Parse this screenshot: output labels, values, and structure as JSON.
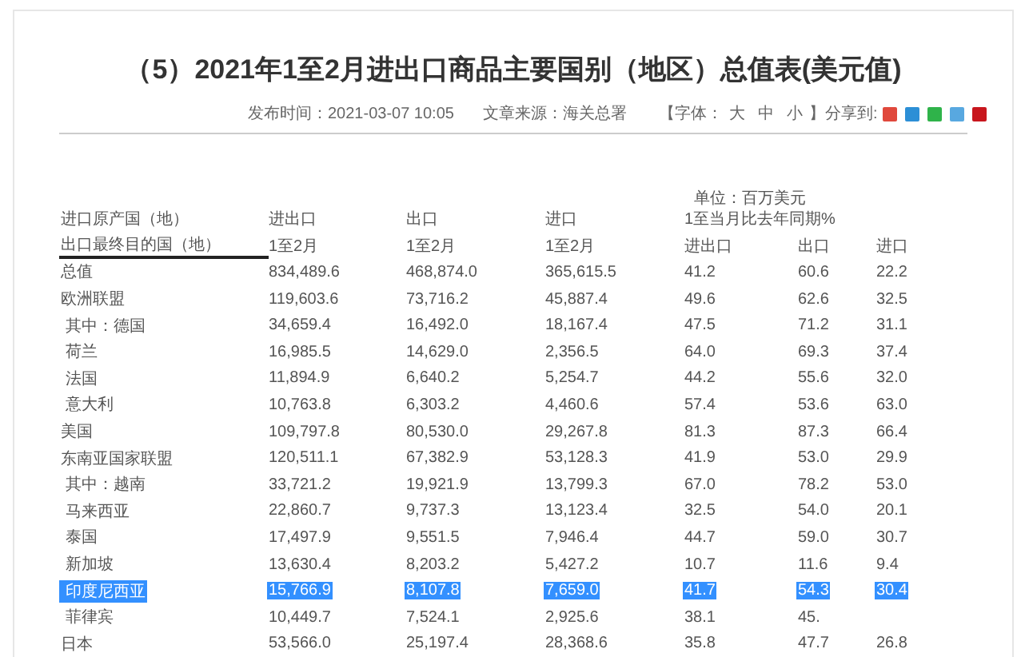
{
  "title": "（5）2021年1至2月进出口商品主要国别（地区）总值表(美元值)",
  "meta": {
    "published": "发布时间：2021-03-07 10:05",
    "source": "文章来源：海关总署",
    "font_label": "【字体：",
    "font_sizes": [
      "大",
      "中",
      "小"
    ],
    "font_end": "】",
    "share_label": "分享到:"
  },
  "share_icons": [
    {
      "color": "#e0483c"
    },
    {
      "color": "#2c8fd6"
    },
    {
      "color": "#2fb34a"
    },
    {
      "color": "#58a8e0"
    },
    {
      "color": "#c8161d"
    }
  ],
  "table": {
    "unit": "单位：百万美元",
    "header_1": [
      "进口原产国（地）",
      "进出口",
      "出口",
      "进口",
      "1至当月比去年同期%"
    ],
    "header_2": [
      "出口最终目的国（地）",
      "1至2月",
      "1至2月",
      "1至2月",
      "进出口",
      "出口",
      "进口"
    ],
    "rows": [
      {
        "cells": [
          "总值",
          "834,489.6",
          "468,874.0",
          "365,615.5",
          "41.2",
          "60.6",
          "22.2"
        ],
        "selected": false
      },
      {
        "cells": [
          "欧洲联盟",
          "119,603.6",
          "73,716.2",
          "45,887.4",
          "49.6",
          "62.6",
          "32.5"
        ],
        "selected": false,
        "children": [
          {
            "cells": [
              "其中：德国",
              "34,659.4",
              "16,492.0",
              "18,167.4",
              "47.5",
              "71.2",
              "31.1"
            ],
            "selected": false
          },
          {
            "cells": [
              "荷兰",
              "16,985.5",
              "14,629.0",
              "2,356.5",
              "64.0",
              "69.3",
              "37.4"
            ],
            "selected": false
          },
          {
            "cells": [
              "法国",
              "11,894.9",
              "6,640.2",
              "5,254.7",
              "44.2",
              "55.6",
              "32.0"
            ],
            "selected": false
          },
          {
            "cells": [
              "意大利",
              "10,763.8",
              "6,303.2",
              "4,460.6",
              "57.4",
              "53.6",
              "63.0"
            ],
            "selected": false
          }
        ]
      },
      {
        "cells": [
          "美国",
          "109,797.8",
          "80,530.0",
          "29,267.8",
          "81.3",
          "87.3",
          "66.4"
        ],
        "selected": false
      },
      {
        "cells": [
          "东南亚国家联盟",
          "120,511.1",
          "67,382.9",
          "53,128.3",
          "41.9",
          "53.0",
          "29.9"
        ],
        "selected": false,
        "children": [
          {
            "cells": [
              "其中：越南",
              "33,721.2",
              "19,921.9",
              "13,799.3",
              "67.0",
              "78.2",
              "53.0"
            ],
            "selected": false
          },
          {
            "cells": [
              "马来西亚",
              "22,860.7",
              "9,737.3",
              "13,123.4",
              "32.5",
              "54.0",
              "20.1"
            ],
            "selected": false
          },
          {
            "cells": [
              "泰国",
              "17,497.9",
              "9,551.5",
              "7,946.4",
              "44.7",
              "59.0",
              "30.7"
            ],
            "selected": false
          },
          {
            "cells": [
              "新加坡",
              "13,630.4",
              "8,203.2",
              "5,427.2",
              "10.7",
              "11.6",
              "9.4"
            ],
            "selected": false
          },
          {
            "cells": [
              "印度尼西亚",
              "15,766.9",
              "8,107.8",
              "7,659.0",
              "41.7",
              "54.3",
              "30.4"
            ],
            "selected": true
          },
          {
            "cells": [
              "菲律宾",
              "10,449.7",
              "7,524.1",
              "2,925.6",
              "38.1",
              "45."
            ],
            "selected": false
          }
        ]
      },
      {
        "cells": [
          "日本",
          "53,566.0",
          "25,197.4",
          "28,368.6",
          "35.8",
          "47.7",
          "26.8"
        ],
        "selected": false
      }
    ]
  }
}
